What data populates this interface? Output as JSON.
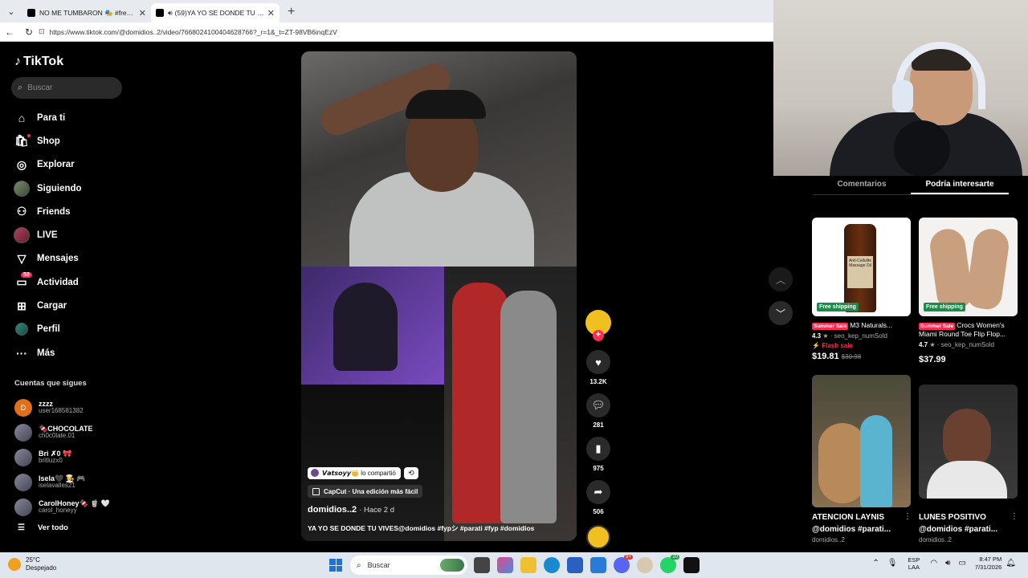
{
  "browser": {
    "tabs": [
      {
        "title": "NO ME TUMBARON 🎭 #freefire #",
        "active": false
      },
      {
        "title": "(59)YA YO SE DONDE TU VIVE",
        "active": true
      }
    ],
    "url": "https://www.tiktok.com/@domidios..2/video/7668024100404628766?_r=1&_t=ZT-98VB6inqEzV"
  },
  "tiktok": {
    "logo": "TikTok",
    "search_placeholder": "Buscar",
    "menu": [
      {
        "label": "Para ti",
        "icon": "home-icon"
      },
      {
        "label": "Shop",
        "icon": "shop-icon"
      },
      {
        "label": "Explorar",
        "icon": "compass-icon"
      },
      {
        "label": "Siguiendo",
        "icon": "following-avatar-icon"
      },
      {
        "label": "Friends",
        "icon": "friends-icon"
      },
      {
        "label": "LIVE",
        "icon": "live-avatar-icon"
      },
      {
        "label": "Mensajes",
        "icon": "send-icon"
      },
      {
        "label": "Actividad",
        "icon": "activity-icon",
        "badge": "59"
      },
      {
        "label": "Cargar",
        "icon": "upload-icon"
      },
      {
        "label": "Perfil",
        "icon": "profile-avatar-icon"
      },
      {
        "label": "Más",
        "icon": "more-icon"
      }
    ],
    "following_title": "Cuentas que sigues",
    "following": [
      {
        "name": "zzzz",
        "user": "user168581382",
        "initial": "D"
      },
      {
        "name": "🍫CHOCOLATE",
        "user": "ch0c0late.01",
        "initial": ""
      },
      {
        "name": "Bri ✗0 🎀",
        "user": "britluzx0",
        "initial": ""
      },
      {
        "name": "Isela🖤 👩‍🍳 🎮",
        "user": "iselavalles21",
        "initial": ""
      },
      {
        "name": "CarolHoney🍫 🧋 🤍",
        "user": "carol_honeyy",
        "initial": ""
      }
    ],
    "see_all": "Ver todo"
  },
  "video": {
    "shared_by": "𝙑𝙖𝙩𝙨𝙤𝙮𝙮👑",
    "shared_label": "lo compartió",
    "capcut": "CapCut · Una edición más fácil",
    "author": "domidios..2",
    "ago": "· Hace 2 d",
    "caption": "YA YO SE DONDE TU VIVES@domidios #fypシ #parati #fyp #domidios",
    "likes": "13.2K",
    "comments": "281",
    "saves": "975",
    "shares": "506"
  },
  "panel": {
    "tabs": [
      "Comentarios",
      "Podría interesarte"
    ],
    "active_tab": 1,
    "products": [
      {
        "sale": "Summer Sale",
        "title": "M3 Naturals...",
        "rating": "4.3",
        "sold": "seo_kep_numSold",
        "flash": "Flash sale",
        "price": "$19.81",
        "old_price": "$30.98",
        "shipping": "Free shipping",
        "bottle_label": "Anti-Cellulite Massage Oil"
      },
      {
        "sale": "Summer Sale",
        "title": "Crocs Women's Miami Round Toe Flip Flop...",
        "rating": "4.7",
        "sold": "seo_kep_numSold",
        "price": "$37.99",
        "shipping": "Free shipping"
      }
    ],
    "videos": [
      {
        "title": "ATENCION LAYNIS @domidios #parati...",
        "user": "domidios..2"
      },
      {
        "title": "LUNES POSITIVO @domidios #parati...",
        "user": "domidios..2"
      }
    ]
  },
  "taskbar": {
    "temp": "25°C",
    "weather": "Despejado",
    "search": "Buscar",
    "lang1": "ESP",
    "lang2": "LAA",
    "time": "8:47 PM",
    "date": "7/31/2026",
    "badge_whatsapp": "20",
    "badge_discord": "9+"
  },
  "colors": {
    "tiktok_red": "#fe2c55",
    "free_shipping_green": "#1e8a4a"
  }
}
